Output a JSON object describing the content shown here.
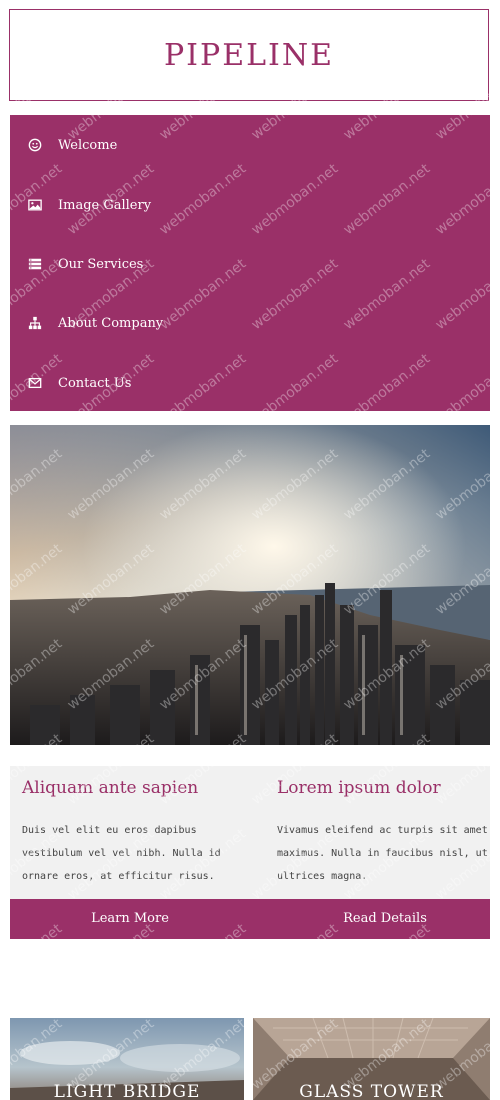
{
  "header": {
    "logo": "PIPELINE"
  },
  "nav": {
    "items": [
      {
        "label": "Welcome",
        "icon": "smile-icon"
      },
      {
        "label": "Image Gallery",
        "icon": "image-icon"
      },
      {
        "label": "Our Services",
        "icon": "services-list-icon"
      },
      {
        "label": "About Company",
        "icon": "org-chart-icon"
      },
      {
        "label": "Contact Us",
        "icon": "envelope-icon"
      }
    ]
  },
  "hero": {
    "image": "city-skyline-sunset"
  },
  "cards": [
    {
      "title": "Aliquam ante sapien",
      "text": "Duis vel elit eu eros dapibus vestibulum vel vel nibh. Nulla id ornare eros, at efficitur risus."
    },
    {
      "title": "Lorem ipsum dolor",
      "text": "Vivamus eleifend ac turpis sit amet maximus. Nulla in faucibus nisl, ut ultrices magna."
    }
  ],
  "cta": {
    "learn_more": "Learn More",
    "read_details": "Read Details"
  },
  "tiles": [
    {
      "label": "LIGHT BRIDGE",
      "image": "sky-photo"
    },
    {
      "label": "GLASS TOWER",
      "image": "tower-photo"
    }
  ],
  "watermark": "webmoban.net",
  "colors": {
    "accent": "#9a3068",
    "panel": "#f1f1f1"
  }
}
